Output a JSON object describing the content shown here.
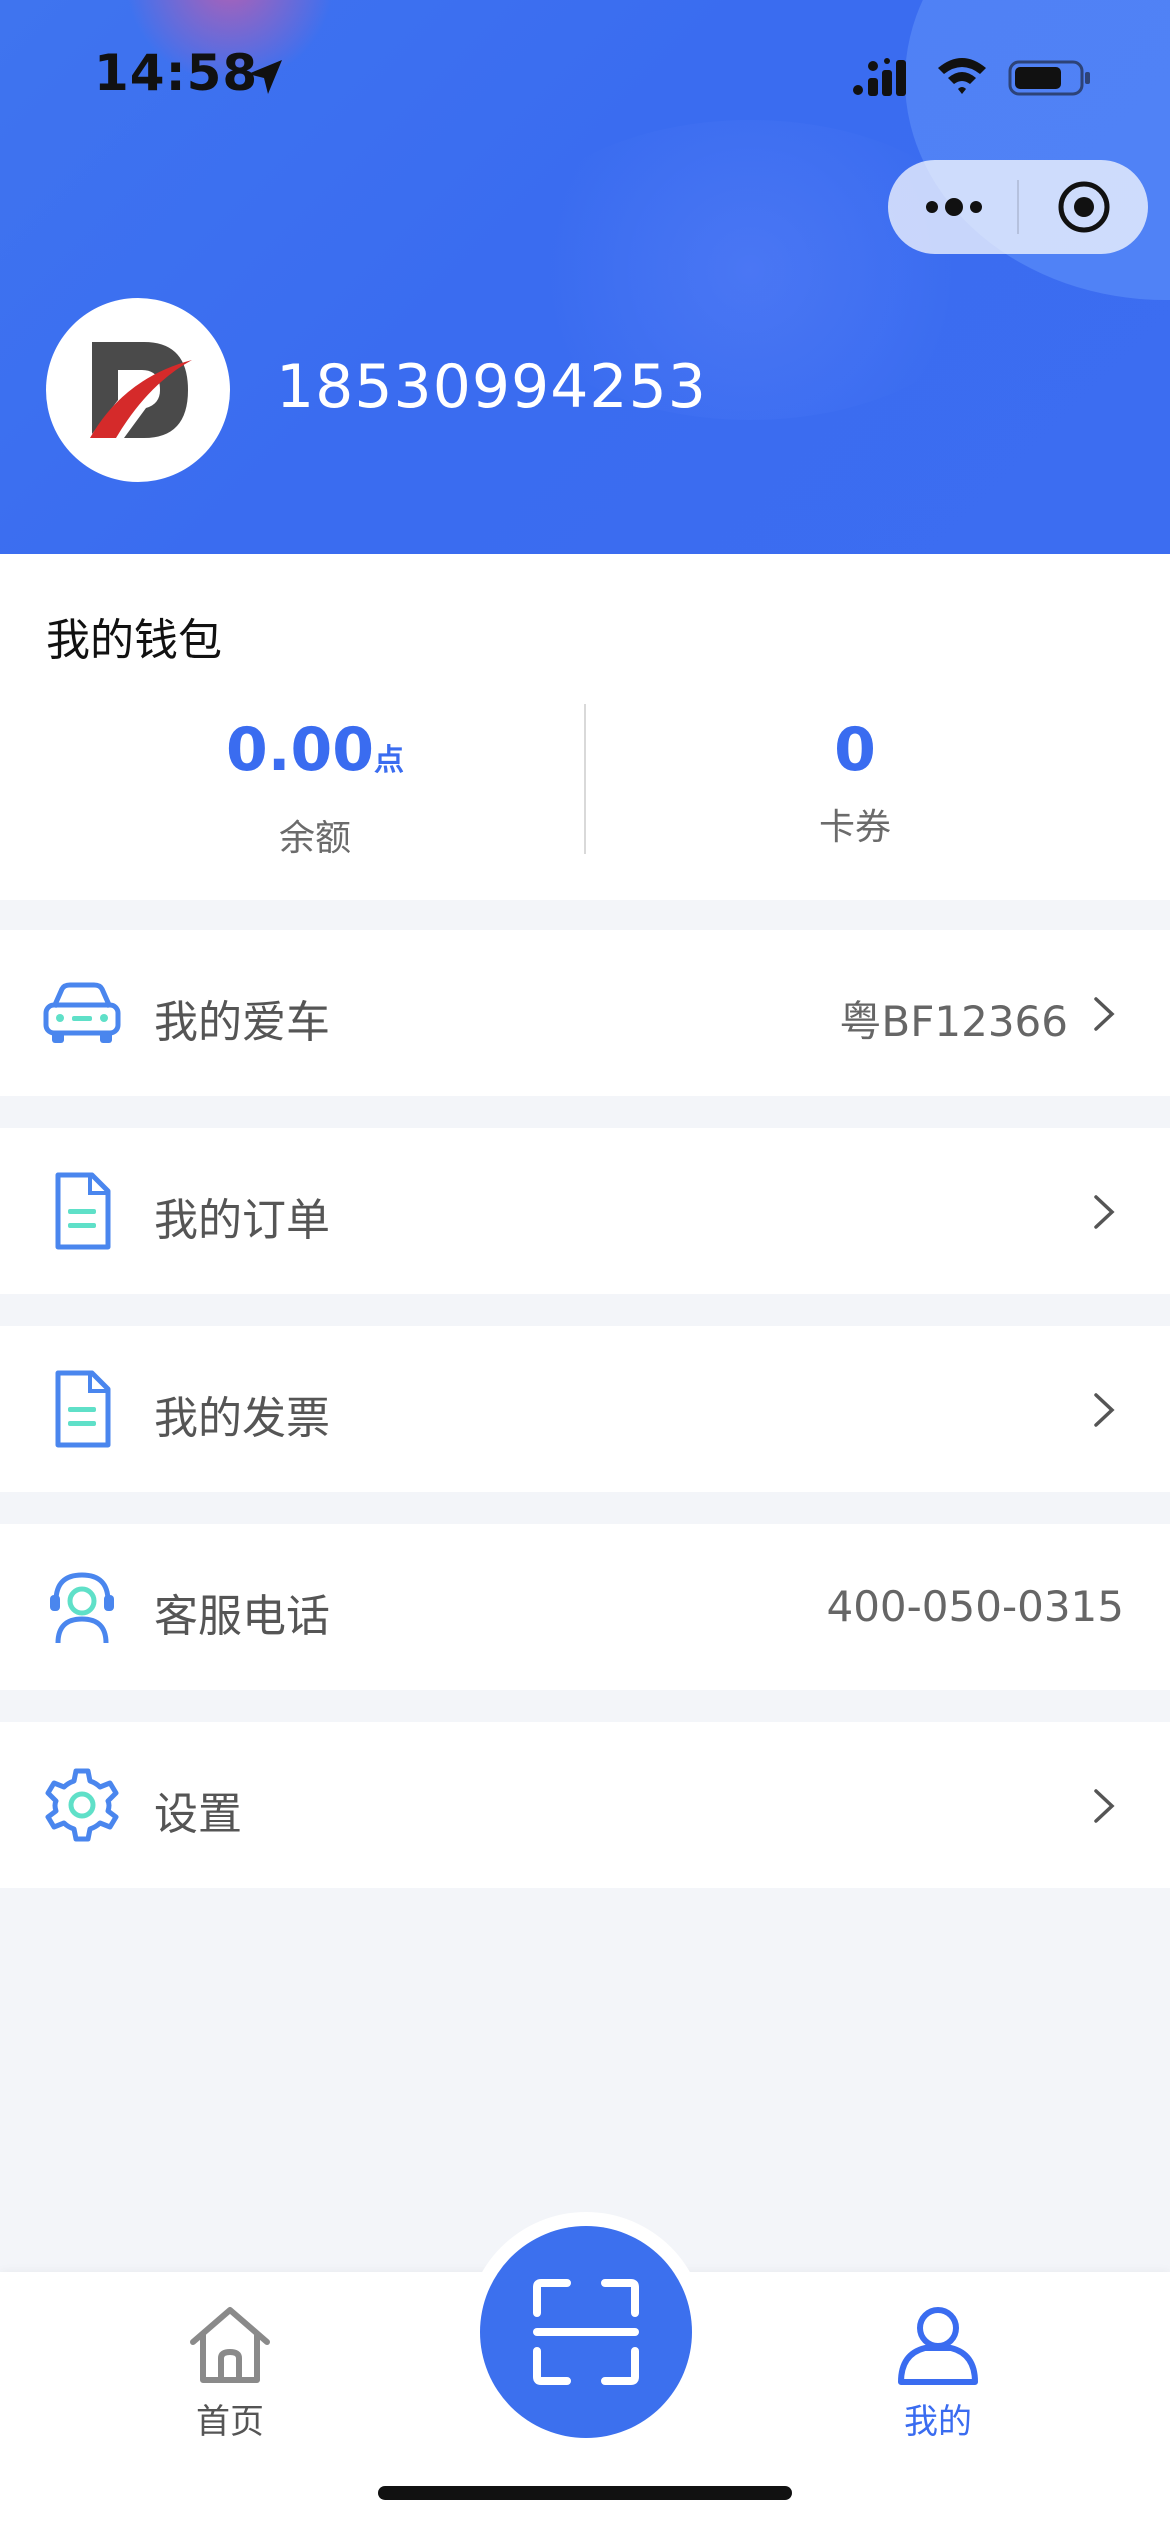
{
  "status_bar": {
    "time": "14:58"
  },
  "header": {
    "phone": "18530994253"
  },
  "wallet": {
    "title": "我的钱包",
    "balance_value": "0.00",
    "balance_unit": "点",
    "balance_label": "余额",
    "coupons_value": "0",
    "coupons_label": "卡券"
  },
  "menu": [
    {
      "label": "我的爱车",
      "value": "粤BF12366",
      "icon": "car-icon"
    },
    {
      "label": "我的订单",
      "value": "",
      "icon": "document-icon"
    },
    {
      "label": "我的发票",
      "value": "",
      "icon": "invoice-icon"
    },
    {
      "label": "客服电话",
      "value": "400-050-0315",
      "icon": "customer-service-icon"
    },
    {
      "label": "设置",
      "value": "",
      "icon": "gear-icon"
    }
  ],
  "tabbar": {
    "home_label": "首页",
    "me_label": "我的"
  },
  "colors": {
    "accent": "#3a6cf0",
    "teal": "#5fe0c8"
  }
}
